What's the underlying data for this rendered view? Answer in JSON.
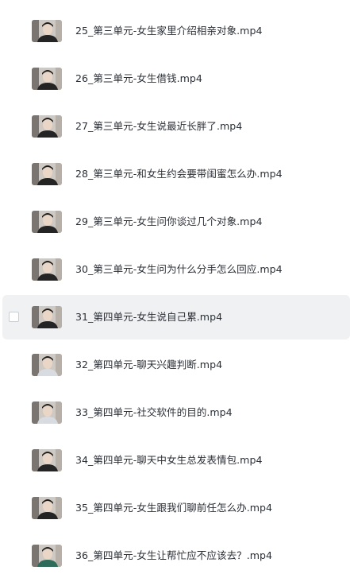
{
  "files": [
    {
      "name": "25_第三单元-女生家里介绍相亲对象.mp4",
      "thumbnail": "video-thumbnail-person"
    },
    {
      "name": "26_第三单元-女生借钱.mp4",
      "thumbnail": "video-thumbnail-person"
    },
    {
      "name": "27_第三单元-女生说最近长胖了.mp4",
      "thumbnail": "video-thumbnail-person"
    },
    {
      "name": "28_第三单元-和女生约会要带闺蜜怎么办.mp4",
      "thumbnail": "video-thumbnail-person"
    },
    {
      "name": "29_第三单元-女生问你谈过几个对象.mp4",
      "thumbnail": "video-thumbnail-person"
    },
    {
      "name": "30_第三单元-女生问为什么分手怎么回应.mp4",
      "thumbnail": "video-thumbnail-person"
    },
    {
      "name": "31_第四单元-女生说自己累.mp4",
      "thumbnail": "video-thumbnail-person"
    },
    {
      "name": "32_第四单元-聊天兴趣判断.mp4",
      "thumbnail": "video-thumbnail-person"
    },
    {
      "name": "33_第四单元-社交软件的目的.mp4",
      "thumbnail": "video-thumbnail-person"
    },
    {
      "name": "34_第四单元-聊天中女生总发表情包.mp4",
      "thumbnail": "video-thumbnail-person"
    },
    {
      "name": "35_第四单元-女生跟我们聊前任怎么办.mp4",
      "thumbnail": "video-thumbnail-person"
    },
    {
      "name": "36_第四单元-女生让帮忙应不应该去？.mp4",
      "thumbnail": "video-thumbnail-person"
    }
  ],
  "hovered_index": 6,
  "colors": {
    "hover_background": "#f0f1f3",
    "text": "#2b2f36",
    "checkbox_border": "#c9cdd4"
  }
}
